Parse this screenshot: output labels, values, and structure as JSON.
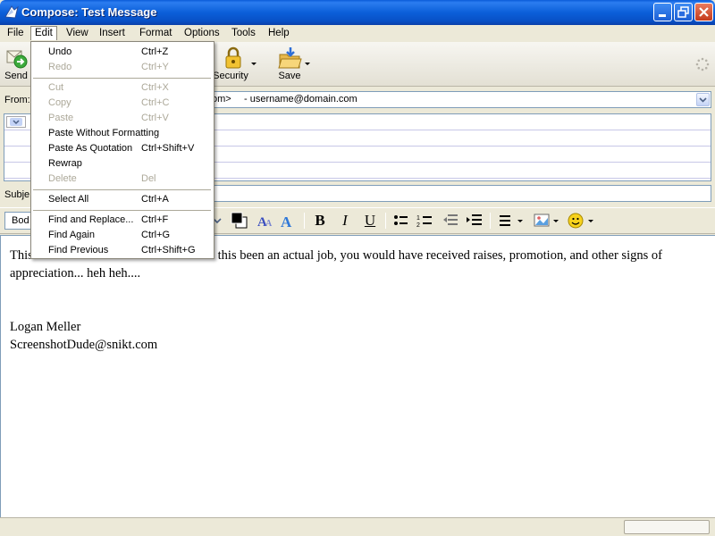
{
  "window": {
    "title": "Compose: Test Message"
  },
  "menubar": {
    "items": [
      "File",
      "Edit",
      "View",
      "Insert",
      "Format",
      "Options",
      "Tools",
      "Help"
    ]
  },
  "toolbar": {
    "send_label": "Send",
    "security_label": "Security",
    "save_label": "Save"
  },
  "header": {
    "from_label": "From:",
    "from_fragment": "om>",
    "from_value": "- username@domain.com",
    "subject_label": "Subje"
  },
  "format_bar": {
    "paragraph_value": "Bod",
    "bold": "B",
    "italic": "I",
    "underline": "U",
    "text_color": "#000000",
    "background_color": "#ffffff"
  },
  "editor": {
    "line1": "This",
    "line1_rest": "d this been an actual job, you would have received raises, promotion, and other signs of",
    "line2": "appreciation... heh heh....",
    "signature_name": "Logan Meller",
    "signature_email": "ScreenshotDude@snikt.com"
  },
  "edit_menu": {
    "items": [
      {
        "label": "Undo",
        "shortcut": "Ctrl+Z",
        "enabled": true
      },
      {
        "label": "Redo",
        "shortcut": "Ctrl+Y",
        "enabled": false
      },
      {
        "label": "Cut",
        "shortcut": "Ctrl+X",
        "enabled": false
      },
      {
        "label": "Copy",
        "shortcut": "Ctrl+C",
        "enabled": false
      },
      {
        "label": "Paste",
        "shortcut": "Ctrl+V",
        "enabled": false
      },
      {
        "label": "Paste Without Formatting",
        "shortcut": "",
        "enabled": true
      },
      {
        "label": "Paste As Quotation",
        "shortcut": "Ctrl+Shift+V",
        "enabled": true
      },
      {
        "label": "Rewrap",
        "shortcut": "",
        "enabled": true
      },
      {
        "label": "Delete",
        "shortcut": "Del",
        "enabled": false
      },
      {
        "label": "Select All",
        "shortcut": "Ctrl+A",
        "enabled": true
      },
      {
        "label": "Find and Replace...",
        "shortcut": "Ctrl+F",
        "enabled": true
      },
      {
        "label": "Find Again",
        "shortcut": "Ctrl+G",
        "enabled": true
      },
      {
        "label": "Find Previous",
        "shortcut": "Ctrl+Shift+G",
        "enabled": true
      }
    ]
  },
  "icons": {
    "send": "send-arrow-icon",
    "security": "padlock-icon",
    "save": "folder-save-icon",
    "throbber": "activity-throbber-icon",
    "smiley": "smiley-icon"
  },
  "colors": {
    "titlebar": "#0a5bd8",
    "menu_disabled": "#aca899",
    "window_bg": "#ece9d8"
  }
}
